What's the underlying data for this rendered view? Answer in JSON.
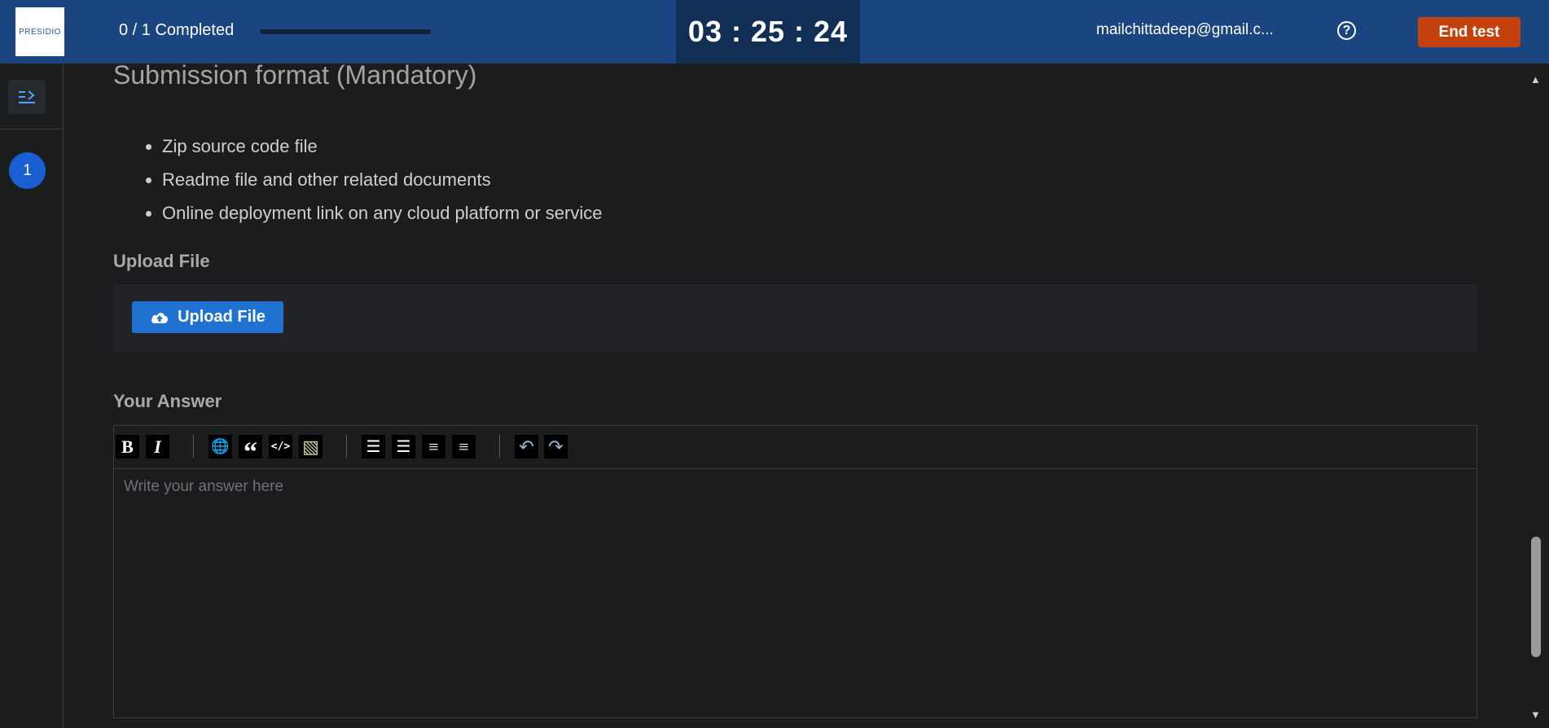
{
  "header": {
    "logo_text": "PRESIDIO",
    "progress_text": "0 / 1 Completed",
    "progress_fraction": 0,
    "timer": {
      "h": "03",
      "m": "25",
      "s": "24",
      "sep": " : "
    },
    "email": "mailchittadeep@gmail.c...",
    "help_icon": "question-circle-icon",
    "end_label": "End test"
  },
  "sidebar": {
    "toggle_icon": "panel-expand-icon",
    "question_number": "1"
  },
  "main": {
    "heading": "Submission format (Mandatory)",
    "bullets": [
      "Zip source code file",
      "Readme file and other related documents",
      "Online deployment link on any cloud platform or service"
    ],
    "upload_section_label": "Upload File",
    "upload_button_label": "Upload File",
    "upload_icon": "cloud-upload-icon",
    "answer_section_label": "Your Answer",
    "answer_placeholder": "Write your answer here",
    "toolbar": [
      {
        "name": "bold-button",
        "glyph": "B",
        "icon": "bold-icon"
      },
      {
        "name": "italic-button",
        "glyph": "I",
        "icon": "italic-icon"
      },
      {
        "name": "link-button",
        "glyph": "🌐",
        "icon": "globe-link-icon"
      },
      {
        "name": "quote-button",
        "glyph": "“",
        "icon": "quote-icon"
      },
      {
        "name": "code-button",
        "glyph": "</>",
        "icon": "code-icon"
      },
      {
        "name": "image-button",
        "glyph": "▧",
        "icon": "image-icon"
      },
      {
        "name": "numbered-list-button",
        "glyph": "☰",
        "icon": "numbered-list-icon"
      },
      {
        "name": "bulleted-list-button",
        "glyph": "☰",
        "icon": "bulleted-list-icon"
      },
      {
        "name": "heading-button",
        "glyph": "≡",
        "icon": "heading-icon"
      },
      {
        "name": "horizontal-rule-button",
        "glyph": "≡",
        "icon": "horizontal-rule-icon"
      },
      {
        "name": "undo-button",
        "glyph": "↶",
        "icon": "undo-icon"
      },
      {
        "name": "redo-button",
        "glyph": "↷",
        "icon": "redo-icon"
      }
    ]
  },
  "colors": {
    "header_bg": "#1a4580",
    "timer_bg": "#112e55",
    "end_button": "#c2410c",
    "upload_button": "#1f72d1",
    "page_bg": "#1b1c1e"
  }
}
